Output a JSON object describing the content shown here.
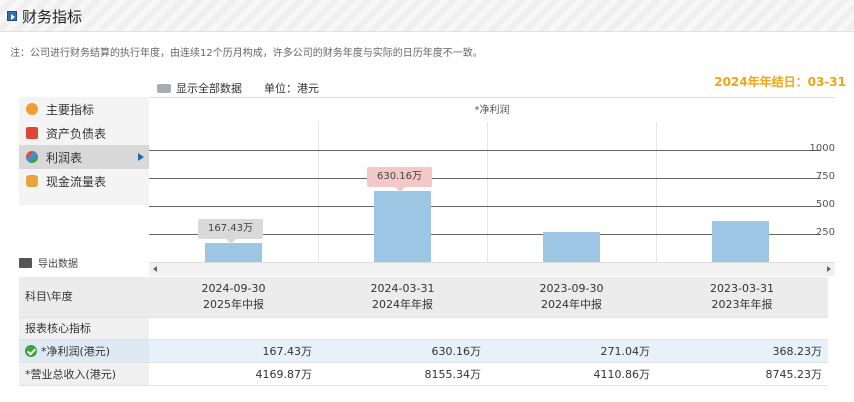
{
  "header": {
    "title": "财务指标"
  },
  "note": "注：公司进行财务结算的执行年度，由连续12个历月构成，许多公司的财务年度与实际的日历年度不一致。",
  "toolbar": {
    "show_all": "显示全部数据",
    "unit": "单位：港元"
  },
  "fiscal_year_end": "2024年年结日：03-31",
  "sidebar": {
    "items": [
      {
        "label": "主要指标",
        "icon": "gear-icon",
        "color": "#f0a030"
      },
      {
        "label": "资产负债表",
        "icon": "document-icon",
        "color": "#e0453a"
      },
      {
        "label": "利润表",
        "icon": "globe-icon",
        "color": "#4a9a3a",
        "active": true
      },
      {
        "label": "现金流量表",
        "icon": "coins-icon",
        "color": "#e7a43a"
      }
    ],
    "export_label": "导出数据"
  },
  "chart_data": {
    "type": "bar",
    "title": "*净利润",
    "categories": [
      "2024-09-30",
      "2024-03-31",
      "2023-09-30",
      "2023-03-31"
    ],
    "series": [
      {
        "name": "*净利润",
        "values": [
          167.43,
          630.16,
          271.04,
          368.23
        ]
      }
    ],
    "value_labels": [
      "167.43万",
      "630.16万",
      "",
      ""
    ],
    "yticks": [
      250,
      500,
      750,
      1000
    ],
    "ylim": [
      0,
      1000
    ],
    "legend": "none",
    "grid": true
  },
  "table": {
    "corner": "科目\\年度",
    "columns": [
      {
        "date": "2024-09-30",
        "report": "2025年中报"
      },
      {
        "date": "2024-03-31",
        "report": "2024年年报"
      },
      {
        "date": "2023-09-30",
        "report": "2024年中报"
      },
      {
        "date": "2023-03-31",
        "report": "2023年年报"
      }
    ],
    "section_label": "报表核心指标",
    "rows": [
      {
        "label": "*净利润(港元)",
        "values": [
          "167.43万",
          "630.16万",
          "271.04万",
          "368.23万"
        ],
        "highlight": true
      },
      {
        "label": "*营业总收入(港元)",
        "values": [
          "4169.87万",
          "8155.34万",
          "4110.86万",
          "8745.23万"
        ]
      }
    ]
  }
}
